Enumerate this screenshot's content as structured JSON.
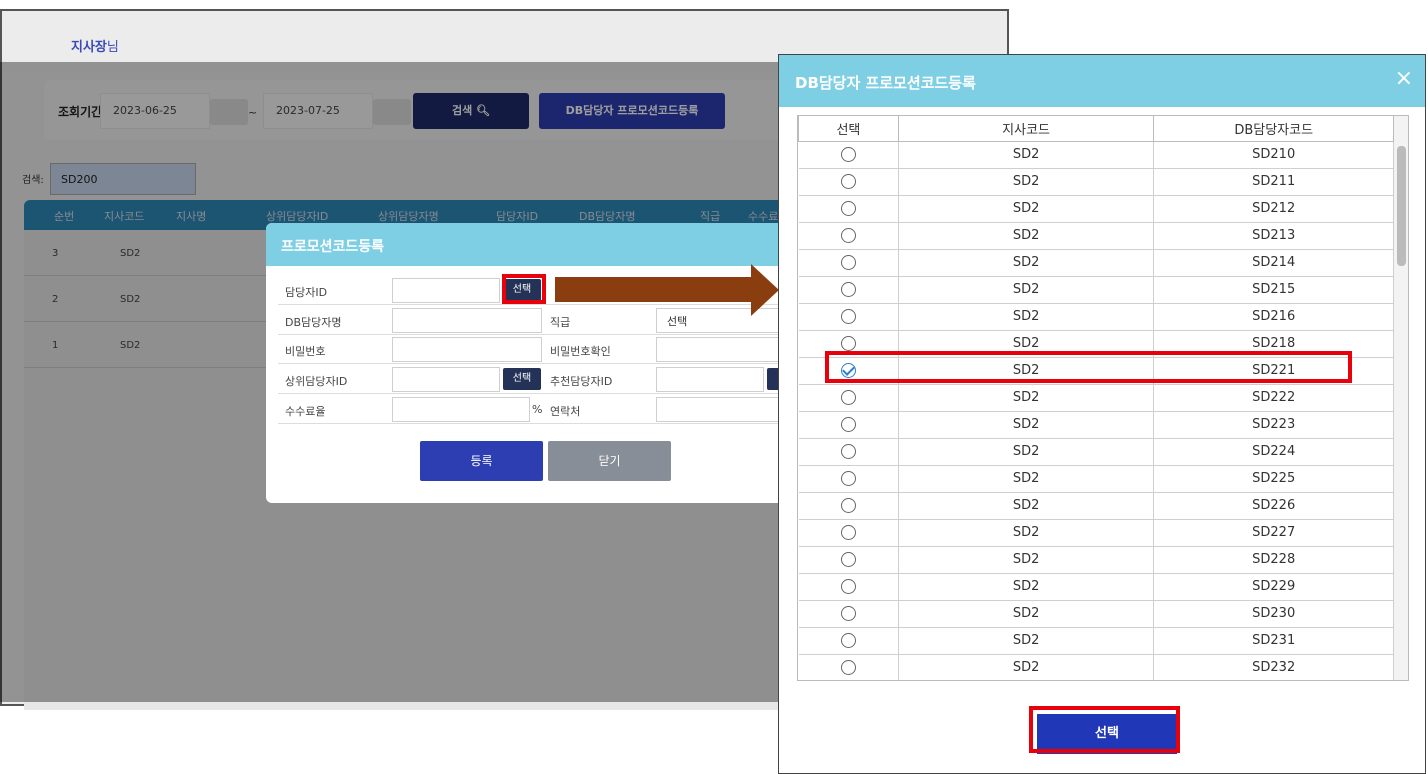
{
  "header": {
    "user_name": "지사장",
    "user_suffix": "님"
  },
  "filter": {
    "period_label": "조회기간",
    "start_date": "2023-06-25",
    "end_date": "2023-07-25",
    "range_sep": "~",
    "search_button": "검색 ",
    "db_register_button": "DB담당자 프로모션코드등록"
  },
  "search": {
    "label": "검색:",
    "value": "SD200"
  },
  "main_table": {
    "columns": [
      "순번",
      "지사코드",
      "지사명",
      "상위담당자ID",
      "상위담당자명",
      "담당자ID",
      "DB담당자명",
      "직급",
      "수수료"
    ],
    "rows": [
      {
        "no": "3",
        "code": "SD2"
      },
      {
        "no": "2",
        "code": "SD2"
      },
      {
        "no": "1",
        "code": "SD2"
      }
    ]
  },
  "promo_dialog": {
    "title": "프로모션코드등록",
    "manager_id_label": "담당자ID",
    "select_label": "선택",
    "db_manager_name_label": "DB담당자명",
    "rank_label": "직급",
    "rank_value": "선택",
    "password_label": "비밀번호",
    "password_confirm_label": "비밀번호확인",
    "parent_manager_label": "상위담당자ID",
    "referrer_label": "추천담당자ID",
    "fee_label": "수수료율",
    "percent": "%",
    "contact_label": "연락처",
    "register_button": "등록",
    "close_button": "닫기"
  },
  "db_dialog": {
    "title": "DB담당자 프로모션코드등록",
    "close_icon": "×",
    "columns": [
      "선택",
      "지사코드",
      "DB담당자코드"
    ],
    "rows": [
      {
        "branch": "SD2",
        "code": "SD210",
        "selected": false
      },
      {
        "branch": "SD2",
        "code": "SD211",
        "selected": false
      },
      {
        "branch": "SD2",
        "code": "SD212",
        "selected": false
      },
      {
        "branch": "SD2",
        "code": "SD213",
        "selected": false
      },
      {
        "branch": "SD2",
        "code": "SD214",
        "selected": false
      },
      {
        "branch": "SD2",
        "code": "SD215",
        "selected": false
      },
      {
        "branch": "SD2",
        "code": "SD216",
        "selected": false
      },
      {
        "branch": "SD2",
        "code": "SD218",
        "selected": false
      },
      {
        "branch": "SD2",
        "code": "SD221",
        "selected": true
      },
      {
        "branch": "SD2",
        "code": "SD222",
        "selected": false
      },
      {
        "branch": "SD2",
        "code": "SD223",
        "selected": false
      },
      {
        "branch": "SD2",
        "code": "SD224",
        "selected": false
      },
      {
        "branch": "SD2",
        "code": "SD225",
        "selected": false
      },
      {
        "branch": "SD2",
        "code": "SD226",
        "selected": false
      },
      {
        "branch": "SD2",
        "code": "SD227",
        "selected": false
      },
      {
        "branch": "SD2",
        "code": "SD228",
        "selected": false
      },
      {
        "branch": "SD2",
        "code": "SD229",
        "selected": false
      },
      {
        "branch": "SD2",
        "code": "SD230",
        "selected": false
      },
      {
        "branch": "SD2",
        "code": "SD231",
        "selected": false
      },
      {
        "branch": "SD2",
        "code": "SD232",
        "selected": false
      }
    ],
    "select_button": "선택"
  },
  "colors": {
    "accent": "#2d3eb2",
    "dialog_header": "#7fcfe4",
    "highlight": "#e8000b",
    "arrow": "#8a3e10"
  }
}
